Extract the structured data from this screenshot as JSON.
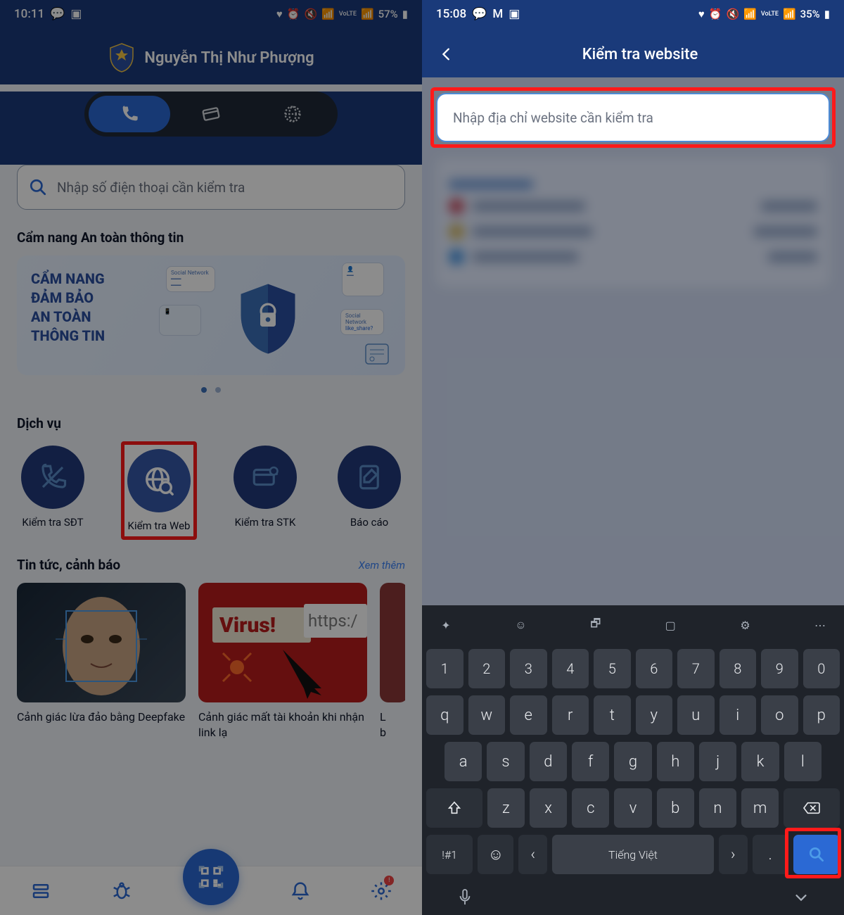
{
  "left": {
    "status": {
      "time": "10:11",
      "battery": "57%"
    },
    "user_name": "Nguyễn Thị Như Phượng",
    "search_placeholder": "Nhập số điện thoại cần kiểm tra",
    "section_handbook": "Cẩm nang An toàn thông tin",
    "banner_line1": "CẨM NANG",
    "banner_line2": "ĐẢM BẢO",
    "banner_line3": "AN TOÀN",
    "banner_line4": "THÔNG TIN",
    "section_services": "Dịch vụ",
    "services": [
      {
        "label": "Kiểm tra SĐT"
      },
      {
        "label": "Kiểm tra Web"
      },
      {
        "label": "Kiểm tra STK"
      },
      {
        "label": "Báo cáo"
      }
    ],
    "news_title": "Tin tức, cảnh báo",
    "view_more": "Xem thêm",
    "news": [
      {
        "caption": "Cảnh giác lừa đảo bằng Deepfake"
      },
      {
        "caption": "Cảnh giác mất tài khoản khi nhận link lạ"
      },
      {
        "caption": "L\nb"
      }
    ]
  },
  "right": {
    "status": {
      "time": "15:08",
      "battery": "35%"
    },
    "title": "Kiểm tra website",
    "input_placeholder": "Nhập địa chỉ website cần kiểm tra",
    "keyboard": {
      "row_num": [
        "1",
        "2",
        "3",
        "4",
        "5",
        "6",
        "7",
        "8",
        "9",
        "0"
      ],
      "row_q": [
        "q",
        "w",
        "e",
        "r",
        "t",
        "y",
        "u",
        "i",
        "o",
        "p"
      ],
      "row_a": [
        "a",
        "s",
        "d",
        "f",
        "g",
        "h",
        "j",
        "k",
        "l"
      ],
      "row_z": [
        "z",
        "x",
        "c",
        "v",
        "b",
        "n",
        "m"
      ],
      "symbols_key": "!#1",
      "lang_label": "Tiếng Việt"
    }
  }
}
